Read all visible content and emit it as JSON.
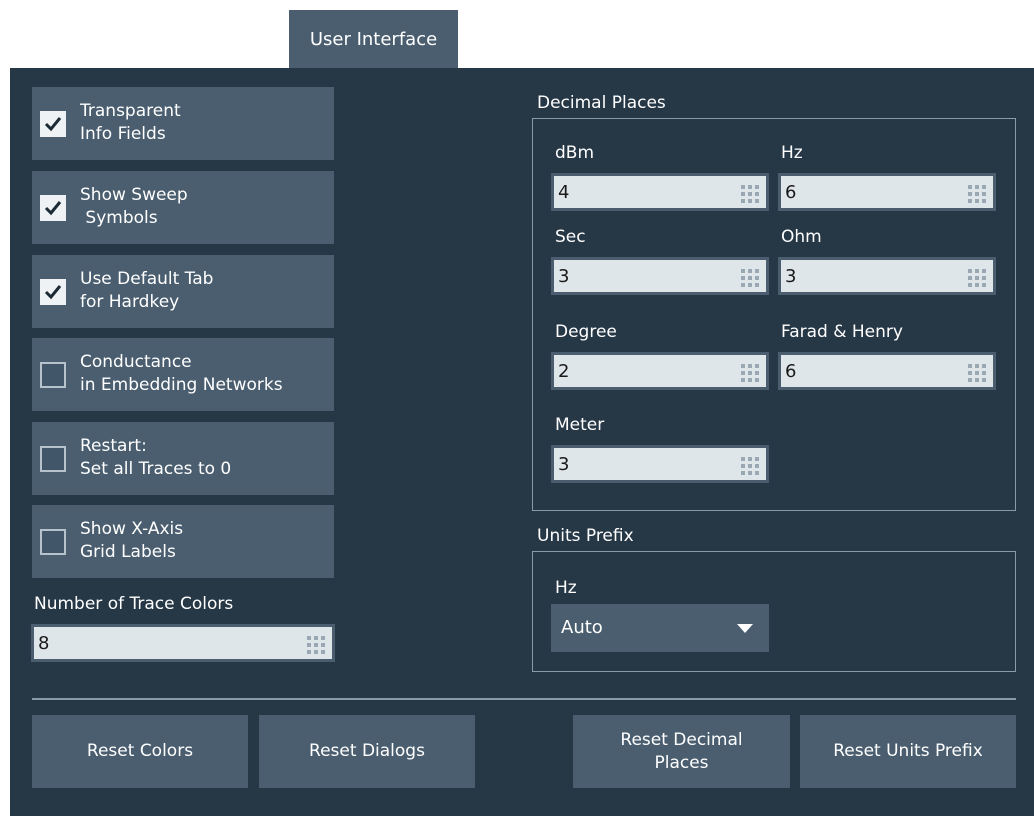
{
  "tab": {
    "label": "User Interface"
  },
  "checkboxes": [
    {
      "label": "Transparent\nInfo Fields",
      "checked": true
    },
    {
      "label": "Show Sweep\n Symbols",
      "checked": true
    },
    {
      "label": "Use Default Tab\nfor Hardkey",
      "checked": true
    },
    {
      "label": "Conductance\nin Embedding Networks",
      "checked": false
    },
    {
      "label": "Restart:\nSet all Traces to 0",
      "checked": false
    },
    {
      "label": "Show X-Axis\nGrid Labels",
      "checked": false
    }
  ],
  "trace_colors": {
    "label": "Number of Trace Colors",
    "value": "8"
  },
  "decimal_places": {
    "title": "Decimal Places",
    "fields": [
      {
        "label": "dBm",
        "value": "4"
      },
      {
        "label": "Hz",
        "value": "6"
      },
      {
        "label": "Sec",
        "value": "3"
      },
      {
        "label": "Ohm",
        "value": "3"
      },
      {
        "label": "Degree",
        "value": "2"
      },
      {
        "label": "Farad & Henry",
        "value": "6"
      },
      {
        "label": "Meter",
        "value": "3"
      }
    ]
  },
  "units_prefix": {
    "title": "Units Prefix",
    "field_label": "Hz",
    "selected": "Auto"
  },
  "buttons": {
    "reset_colors": "Reset Colors",
    "reset_dialogs": "Reset Dialogs",
    "reset_decimal_places": "Reset Decimal\nPlaces",
    "reset_units_prefix": "Reset Units Prefix"
  },
  "colors": {
    "panel_bg": "#263746",
    "control_bg": "#4a5e6f",
    "field_bg": "#dfe6ea",
    "text": "#ffffff"
  }
}
